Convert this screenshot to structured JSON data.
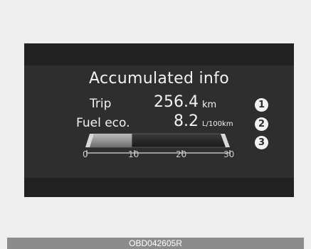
{
  "screen": {
    "title": "Accumulated info",
    "trip": {
      "label": "Trip",
      "value": "256.4",
      "unit": "km",
      "marker": "1"
    },
    "fuel": {
      "label": "Fuel eco.",
      "value": "8.2",
      "unit": "L/100km",
      "marker": "2"
    },
    "gauge": {
      "marker": "3",
      "ticks": [
        "0",
        "10",
        "20",
        "30"
      ],
      "fill_fraction": 0.3
    }
  },
  "footer": {
    "code": "OBD042605R"
  },
  "colors": {
    "display_bg": "#2e2e2e",
    "band": "#222222",
    "text": "#f2f2f2",
    "gauge_fill": "#8a8a8a"
  }
}
